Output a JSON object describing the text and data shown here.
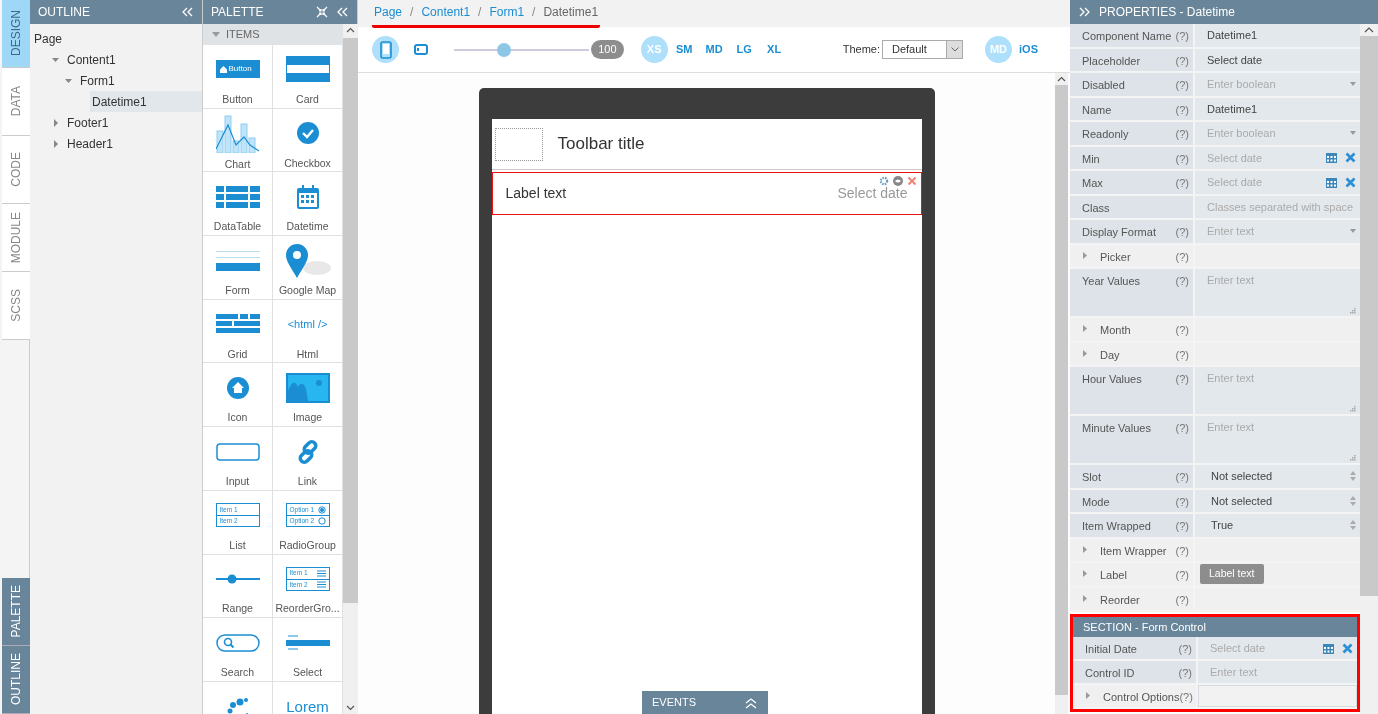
{
  "side_tabs": [
    {
      "label": "DESIGN",
      "selected": true
    },
    {
      "label": "DATA",
      "selected": false
    },
    {
      "label": "CODE",
      "selected": false
    },
    {
      "label": "MODULE",
      "selected": false
    },
    {
      "label": "SCSS",
      "selected": false
    }
  ],
  "bottom_tabs": [
    {
      "label": "PALETTE"
    },
    {
      "label": "OUTLINE"
    }
  ],
  "outline": {
    "title": "OUTLINE",
    "tree": [
      {
        "label": "Page",
        "selected": false,
        "children": [
          {
            "label": "Content1",
            "selected": false,
            "expanded": true,
            "children": [
              {
                "label": "Form1",
                "selected": false,
                "expanded": true,
                "children": [
                  {
                    "label": "Datetime1",
                    "selected": true
                  }
                ]
              }
            ]
          },
          {
            "label": "Footer1",
            "selected": false,
            "expanded": false
          },
          {
            "label": "Header1",
            "selected": false,
            "expanded": false
          }
        ]
      }
    ]
  },
  "palette": {
    "title": "PALETTE",
    "section": {
      "label": "ITEMS",
      "expanded": true
    },
    "items": [
      {
        "label": "Button",
        "kind": "button",
        "icon_text": [
          "Button"
        ]
      },
      {
        "label": "Card",
        "kind": "card"
      },
      {
        "label": "Chart",
        "kind": "chart"
      },
      {
        "label": "Checkbox",
        "kind": "checkbox"
      },
      {
        "label": "DataTable",
        "kind": "datatable"
      },
      {
        "label": "Datetime",
        "kind": "datetime"
      },
      {
        "label": "Form",
        "kind": "form"
      },
      {
        "label": "Google Map",
        "kind": "map"
      },
      {
        "label": "Grid",
        "kind": "grid"
      },
      {
        "label": "Html",
        "kind": "html",
        "icon_text": [
          "<html />"
        ]
      },
      {
        "label": "Icon",
        "kind": "icon"
      },
      {
        "label": "Image",
        "kind": "image"
      },
      {
        "label": "Input",
        "kind": "input"
      },
      {
        "label": "Link",
        "kind": "link"
      },
      {
        "label": "List",
        "kind": "list",
        "icon_text": [
          "Item 1",
          "Item 2"
        ]
      },
      {
        "label": "RadioGroup",
        "kind": "radio",
        "icon_text": [
          "Option 1",
          "Option 2"
        ]
      },
      {
        "label": "Range",
        "kind": "range"
      },
      {
        "label": "ReorderGro...",
        "kind": "reorder",
        "icon_text": [
          "Item 1",
          "Item 2"
        ]
      },
      {
        "label": "Search",
        "kind": "search"
      },
      {
        "label": "Select",
        "kind": "select"
      },
      {
        "kind": "spinner"
      },
      {
        "kind": "text",
        "icon_text": [
          "Lorem"
        ]
      }
    ]
  },
  "breadcrumb": {
    "highlighted": true,
    "separator": "/",
    "items": [
      {
        "label": "Page",
        "current": false
      },
      {
        "label": "Content1",
        "current": false
      },
      {
        "label": "Form1",
        "current": false
      },
      {
        "label": "Datetime1",
        "current": true
      }
    ]
  },
  "toolbar": {
    "devices": [
      {
        "kind": "phone",
        "selected": true
      },
      {
        "kind": "tablet",
        "selected": false
      }
    ],
    "zoom": {
      "level": 0.37,
      "reading": "100"
    },
    "breakpoints": [
      {
        "label": "XS",
        "selected": true
      },
      {
        "label": "SM",
        "selected": false
      },
      {
        "label": "MD",
        "selected": false
      },
      {
        "label": "LG",
        "selected": false
      },
      {
        "label": "XL",
        "selected": false
      }
    ],
    "theme": {
      "label": "Theme:",
      "value": "Default"
    },
    "platforms": [
      {
        "label": "MD",
        "selected": true
      },
      {
        "label": "iOS",
        "selected": false
      }
    ]
  },
  "canvas": {
    "toolbar_title": "Toolbar title",
    "datetime": {
      "label": "Label text",
      "placeholder": "Select date",
      "selected": true
    }
  },
  "events": {
    "title": "EVENTS"
  },
  "properties": {
    "title": "PROPERTIES - Datetime",
    "rows": [
      {
        "label": "Component Name",
        "help": "(?)",
        "kind": "text",
        "value": "Datetime1"
      },
      {
        "label": "Placeholder",
        "help": "(?)",
        "kind": "text",
        "value": "Select date"
      },
      {
        "label": "Disabled",
        "help": "(?)",
        "kind": "combo",
        "placeholder": "Enter boolean"
      },
      {
        "label": "Name",
        "help": "(?)",
        "kind": "text",
        "value": "Datetime1"
      },
      {
        "label": "Readonly",
        "help": "(?)",
        "kind": "combo",
        "placeholder": "Enter boolean"
      },
      {
        "label": "Min",
        "help": "(?)",
        "kind": "date",
        "placeholder": "Select date"
      },
      {
        "label": "Max",
        "help": "(?)",
        "kind": "date",
        "placeholder": "Select date"
      },
      {
        "label": "Class",
        "kind": "text",
        "placeholder": "Classes separated with space"
      },
      {
        "label": "Display Format",
        "help": "(?)",
        "kind": "combo",
        "placeholder": "Enter text"
      },
      {
        "label": "Picker",
        "help": "(?)",
        "kind": "group",
        "expanded": false
      },
      {
        "label": "Year Values",
        "help": "(?)",
        "kind": "textarea",
        "placeholder": "Enter text"
      },
      {
        "label": "Month",
        "help": "(?)",
        "kind": "group",
        "expanded": false
      },
      {
        "label": "Day",
        "help": "(?)",
        "kind": "group",
        "expanded": false
      },
      {
        "label": "Hour Values",
        "help": "(?)",
        "kind": "textarea",
        "placeholder": "Enter text"
      },
      {
        "label": "Minute Values",
        "help": "(?)",
        "kind": "textarea",
        "placeholder": "Enter text"
      },
      {
        "label": "Slot",
        "help": "(?)",
        "kind": "select",
        "value": "Not selected"
      },
      {
        "label": "Mode",
        "help": "(?)",
        "kind": "select",
        "value": "Not selected"
      },
      {
        "label": "Item Wrapped",
        "help": "(?)",
        "kind": "select",
        "value": "True"
      },
      {
        "label": "Item Wrapper",
        "help": "(?)",
        "kind": "group",
        "expanded": false
      },
      {
        "label": "Label",
        "help": "(?)",
        "kind": "chip",
        "value": "Label text",
        "expanded": false
      },
      {
        "label": "Reorder",
        "help": "(?)",
        "kind": "group",
        "expanded": false
      }
    ],
    "section": {
      "title": "SECTION - Form Control",
      "highlighted": true,
      "rows": [
        {
          "label": "Initial Date",
          "help": "(?)",
          "kind": "date",
          "placeholder": "Select date"
        },
        {
          "label": "Control ID",
          "help": "(?)",
          "kind": "text",
          "placeholder": "Enter text"
        },
        {
          "label": "Control Options",
          "help": "(?)",
          "kind": "group",
          "expanded": false
        }
      ]
    }
  }
}
